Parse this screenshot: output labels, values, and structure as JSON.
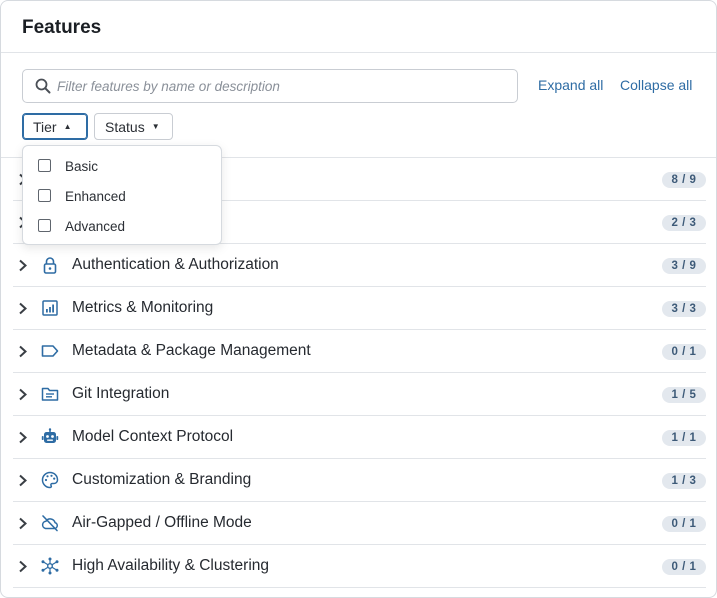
{
  "header": {
    "title": "Features"
  },
  "search": {
    "placeholder": "Filter features by name or description",
    "value": ""
  },
  "actions": {
    "expand_all": "Expand all",
    "collapse_all": "Collapse all"
  },
  "filters": {
    "tier": {
      "label": "Tier",
      "open": true
    },
    "status": {
      "label": "Status",
      "open": false
    }
  },
  "tier_dropdown": {
    "options": [
      {
        "label": "Basic",
        "checked": false
      },
      {
        "label": "Enhanced",
        "checked": false
      },
      {
        "label": "Advanced",
        "checked": false
      }
    ]
  },
  "categories": [
    {
      "label": "",
      "icon": "hidden-icon",
      "badge": "8 / 9"
    },
    {
      "label": "",
      "icon": "hidden-icon",
      "badge": "2 / 3"
    },
    {
      "label": "Authentication & Authorization",
      "icon": "lock-icon",
      "badge": "3 / 9"
    },
    {
      "label": "Metrics & Monitoring",
      "icon": "chart-icon",
      "badge": "3 / 3"
    },
    {
      "label": "Metadata & Package Management",
      "icon": "tag-icon",
      "badge": "0 / 1"
    },
    {
      "label": "Git Integration",
      "icon": "folder-icon",
      "badge": "1 / 5"
    },
    {
      "label": "Model Context Protocol",
      "icon": "robot-icon",
      "badge": "1 / 1"
    },
    {
      "label": "Customization & Branding",
      "icon": "palette-icon",
      "badge": "1 / 3"
    },
    {
      "label": "Air-Gapped / Offline Mode",
      "icon": "cloud-off-icon",
      "badge": "0 / 1"
    },
    {
      "label": "High Availability & Clustering",
      "icon": "cluster-icon",
      "badge": "0 / 1"
    }
  ],
  "colors": {
    "accent": "#2e6ca4",
    "icon": "#2e6ca4",
    "badge_bg": "#e3e8ee",
    "badge_text": "#3d5a78"
  }
}
